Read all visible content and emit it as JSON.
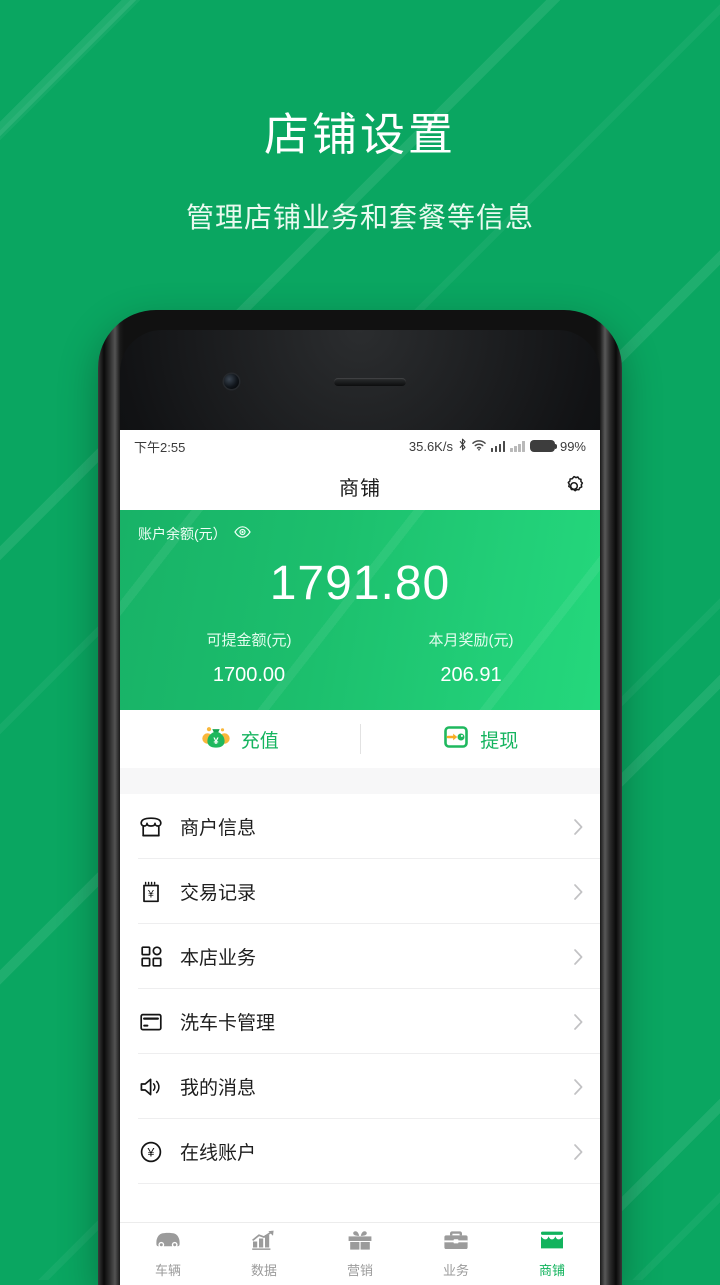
{
  "hero": {
    "title": "店铺设置",
    "subtitle": "管理店铺业务和套餐等信息"
  },
  "colors": {
    "background_green": "#0aa661",
    "brand_green": "#12b35d",
    "card_gradient_start": "#18b267",
    "card_gradient_end": "#24d87c",
    "accent_orange": "#f7ad23",
    "inactive_gray": "#9b9b9b"
  },
  "statusbar": {
    "time": "下午2:55",
    "net_speed": "35.6K/s",
    "bluetooth_icon": "bluetooth-icon",
    "wifi_icon": "wifi-icon",
    "signal_icon": "signal-bars-icon",
    "signal2_icon": "signal-bars-no-sim-icon",
    "battery_icon": "battery-icon",
    "battery_percent": "99%"
  },
  "appbar": {
    "title": "商铺",
    "settings_icon": "gear-icon"
  },
  "balance": {
    "label": "账户余额(元）",
    "eye_icon": "eye-icon",
    "amount": "1791.80",
    "columns": [
      {
        "label": "可提金额(元)",
        "value": "1700.00"
      },
      {
        "label": "本月奖励(元)",
        "value": "206.91"
      }
    ]
  },
  "actions": [
    {
      "label": "充值",
      "icon": "money-bag-icon"
    },
    {
      "label": "提现",
      "icon": "wallet-withdraw-icon"
    }
  ],
  "menu": [
    {
      "label": "商户信息",
      "icon": "store-icon"
    },
    {
      "label": "交易记录",
      "icon": "receipt-yen-icon"
    },
    {
      "label": "本店业务",
      "icon": "grid-icon"
    },
    {
      "label": "洗车卡管理",
      "icon": "card-icon"
    },
    {
      "label": "我的消息",
      "icon": "speaker-icon"
    },
    {
      "label": "在线账户",
      "icon": "yen-circle-icon"
    }
  ],
  "tabbar": [
    {
      "label": "车辆",
      "icon": "car-icon",
      "active": false
    },
    {
      "label": "数据",
      "icon": "chart-icon",
      "active": false
    },
    {
      "label": "营销",
      "icon": "gift-icon",
      "active": false
    },
    {
      "label": "业务",
      "icon": "briefcase-icon",
      "active": false
    },
    {
      "label": "商铺",
      "icon": "store-icon",
      "active": true
    }
  ]
}
